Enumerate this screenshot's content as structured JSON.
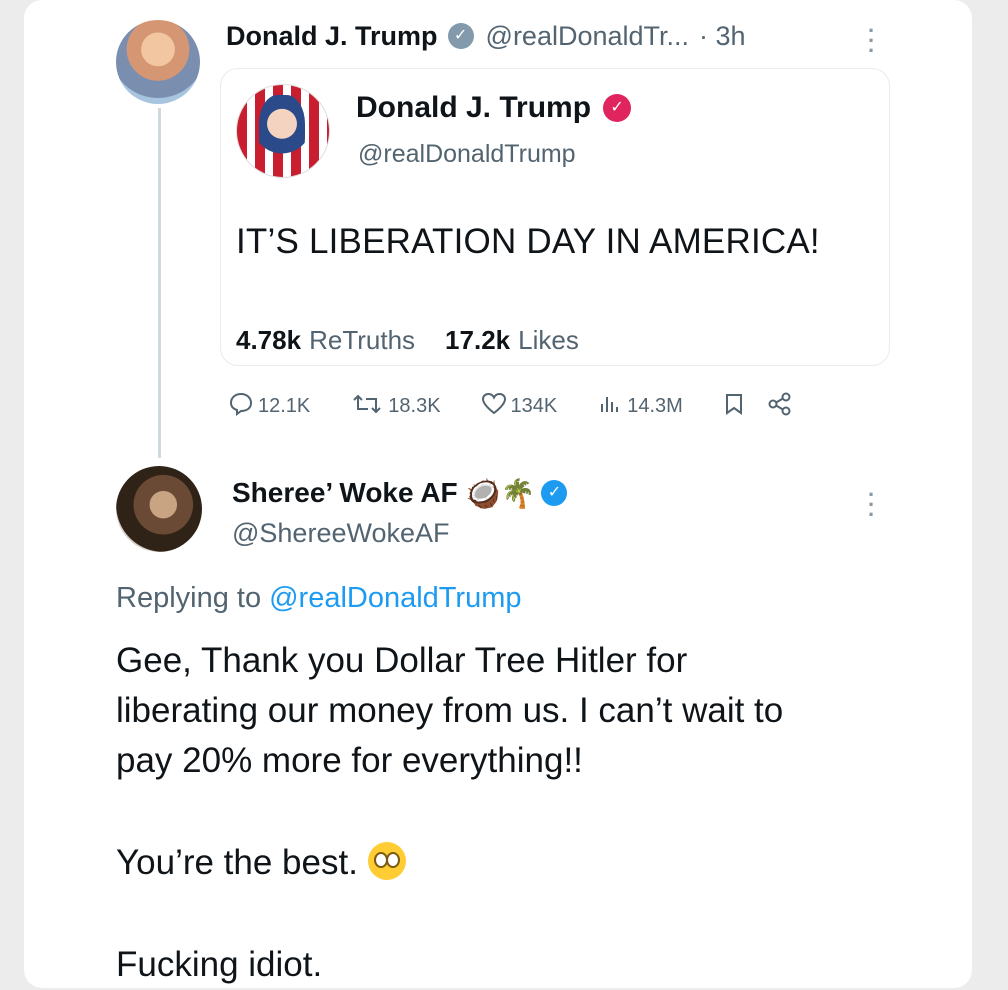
{
  "original_post": {
    "author_name": "Donald J. Trump",
    "handle": "@realDonaldTr...",
    "time": "· 3h",
    "menu_icon": "more-vertical-icon"
  },
  "quoted_truth": {
    "author_name": "Donald J. Trump",
    "handle": "@realDonaldTrump",
    "text": "IT’S LIBERATION DAY IN AMERICA!",
    "retruths_count": "4.78k",
    "retruths_label": "ReTruths",
    "likes_count": "17.2k",
    "likes_label": "Likes",
    "verified_color": "#e0245e"
  },
  "actions": {
    "replies": "12.1K",
    "reposts": "18.3K",
    "likes": "134K",
    "views": "14.3M",
    "icons": [
      "reply-icon",
      "repost-icon",
      "heart-icon",
      "views-icon",
      "bookmark-icon",
      "share-icon"
    ]
  },
  "reply": {
    "author_name": "Sheree’ Woke AF",
    "handle": "@ShereeWokeAF",
    "replying_prefix": "Replying to",
    "replying_handle": "@realDonaldTrump",
    "lines": [
      "Gee, Thank you Dollar Tree Hitler for",
      "liberating our money from us. I can’t wait to",
      "pay 20% more for everything!!"
    ],
    "line_best": "You’re the best.",
    "line_final": "Fucking idiot.",
    "verified_color": "#1d9bf0"
  }
}
